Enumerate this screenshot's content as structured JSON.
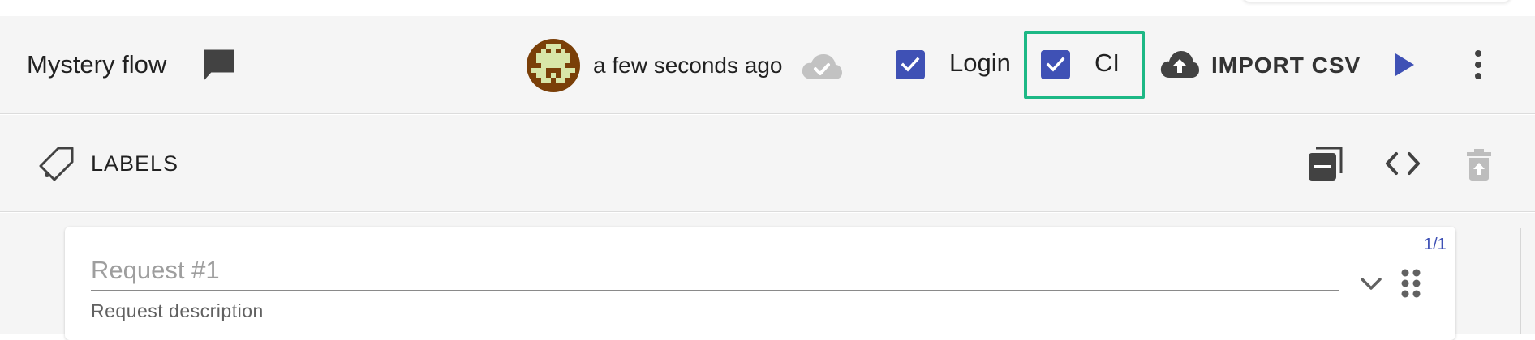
{
  "header": {
    "flow_title": "Mystery flow",
    "saved_time": "a few seconds ago",
    "login_label": "Login",
    "login_checked": true,
    "ci_label": "CI",
    "ci_checked": true,
    "import_label": "IMPORT CSV"
  },
  "labels_bar": {
    "title": "LABELS"
  },
  "request": {
    "counter": "1/1",
    "name_placeholder": "Request #1",
    "description": "Request description"
  },
  "icons": {
    "comment": "comment-icon",
    "cloud_saved": "cloud-check-icon",
    "import": "cloud-upload-icon",
    "run": "play-icon",
    "more": "more-vertical-icon",
    "label": "label-tag-icon",
    "collapse_all": "collapse-all-icon",
    "code": "code-icon",
    "delete": "delete-icon",
    "expand": "chevron-down-icon",
    "drag": "drag-handle-icon"
  },
  "colors": {
    "accent": "#3f51b5",
    "highlight": "#1db885",
    "bar_background": "#f5f5f5"
  }
}
